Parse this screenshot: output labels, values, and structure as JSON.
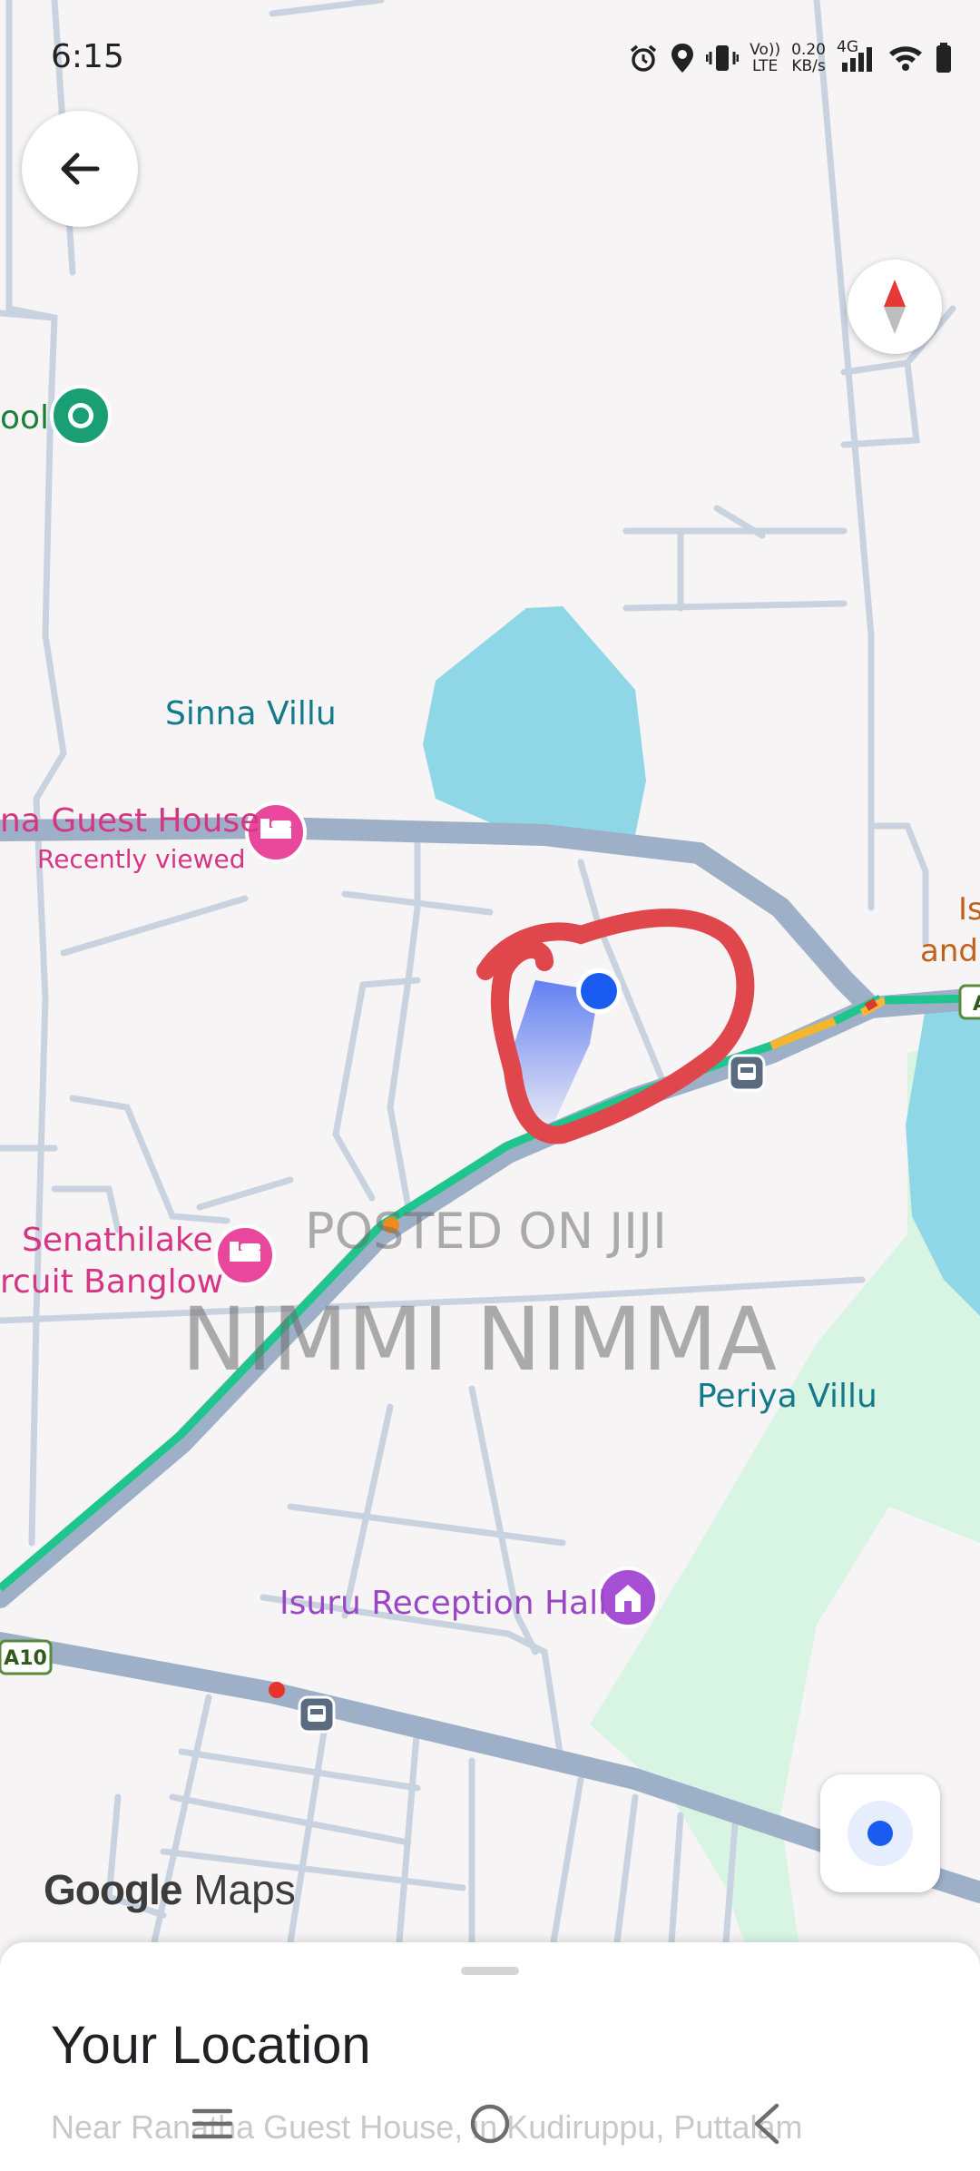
{
  "status_bar": {
    "time": "6:15",
    "net_speed_value": "0.20",
    "net_speed_unit": "KB/s",
    "volte_top": "Vo))",
    "volte_bottom": "LTE",
    "network_type": "4G",
    "icons": [
      "alarm-icon",
      "location-icon",
      "vibrate-icon",
      "volte-icon",
      "signal-icon",
      "wifi-icon",
      "battery-icon"
    ]
  },
  "map": {
    "places": {
      "school_partial": "ool",
      "sinna_villu": "Sinna Villu",
      "guest_house": "na Guest House",
      "recently_viewed": "Recently viewed",
      "senathilake_line1": "Senathilake",
      "senathilake_line2": "rcuit Banglow",
      "periya_villu": "Periya Villu",
      "isuru_hall": "Isuru Reception Hall",
      "right_edge_1": "Is",
      "right_edge_2": "and"
    },
    "road_shields": {
      "a10": "A10",
      "a_right": "A"
    },
    "colors": {
      "water": "#8fd6e6",
      "park": "#d8f5e3",
      "road": "#9db0c7",
      "traffic": "#1ec58c",
      "lodging": "#e8479b",
      "venue": "#a64fd4",
      "my_location": "#1a5cf0",
      "annotation": "#e0474c"
    }
  },
  "watermark": {
    "line1": "POSTED ON JIJI",
    "line2": "NIMMI NIMMA"
  },
  "brand": {
    "google": "Google",
    "maps": "Maps"
  },
  "sheet": {
    "title": "Your Location",
    "subtitle": "Near Ranatha Guest House, in Kudiruppu, Puttalam"
  },
  "nav_bar": {
    "icons": [
      "menu-nav-icon",
      "home-nav-icon",
      "back-nav-icon"
    ]
  }
}
